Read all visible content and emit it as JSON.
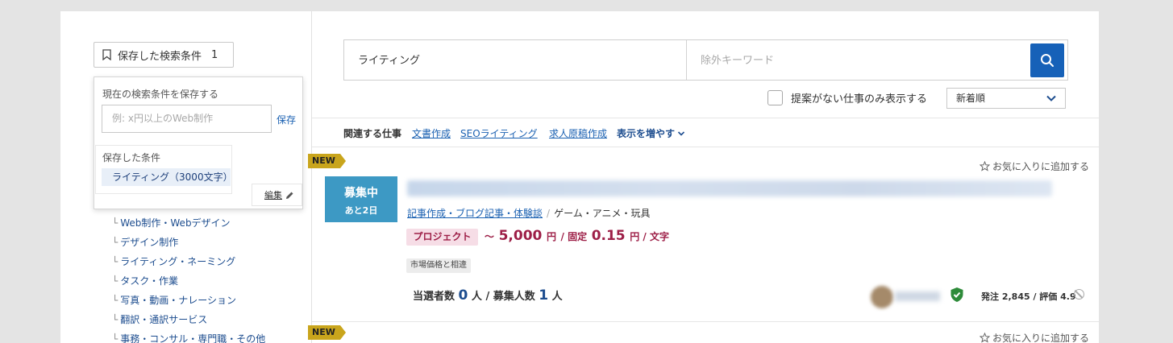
{
  "saved_search": {
    "label": "保存した検索条件",
    "count": "1"
  },
  "popup": {
    "save_title": "現在の検索条件を保存する",
    "input_placeholder": "例: x円以上のWeb制作",
    "save_label": "保存",
    "saved_heading": "保存した条件",
    "saved_item": "ライティング（3000文字）",
    "edit_label": "編集"
  },
  "categories": [
    "Web制作・Webデザイン",
    "デザイン制作",
    "ライティング・ネーミング",
    "タスク・作業",
    "写真・動画・ナレーション",
    "翻訳・通訳サービス",
    "事務・コンサル・専門職・その他"
  ],
  "search": {
    "keyword": "ライティング",
    "exclude_placeholder": "除外キーワード"
  },
  "filters": {
    "no_proposal_label": "提案がない仕事のみ表示する",
    "sort_value": "新着順"
  },
  "related": {
    "label": "関連する仕事",
    "links": [
      "文書作成",
      "SEOライティング",
      "求人原稿作成"
    ],
    "more_label": "表示を増やす"
  },
  "job": {
    "new_badge": "NEW",
    "favorite_label": "お気に入りに追加する",
    "status_line1": "募集中",
    "status_line2": "あと2日",
    "category_link": "記事作成・ブログ記事・体験談",
    "category_separator": "/",
    "category_sub": "ゲーム・アニメ・玩具",
    "type_badge": "プロジェクト",
    "price": {
      "tilde": "～",
      "amount": "5,000",
      "unit": "円",
      "separator": "/ 固定",
      "rate": "0.15",
      "rate_unit": "円 / 文字"
    },
    "market_tag": "市場価格と相違",
    "counts": {
      "selected_label": "当選者数",
      "selected": "0",
      "person": "人",
      "slash": "/",
      "recruit_label": "募集人数",
      "recruit": "1"
    },
    "stats": "発注 2,845 / 評価 4.9"
  },
  "job2": {
    "new_badge": "NEW",
    "favorite_label": "お気に入りに追加する"
  },
  "colors": {
    "accent_blue": "#1661b8",
    "link_blue": "#1b61b2",
    "status_blue": "#3d99c4",
    "price_red": "#9d1f47",
    "new_gold": "#c9a51c",
    "verified_green": "#2e8b3a"
  }
}
